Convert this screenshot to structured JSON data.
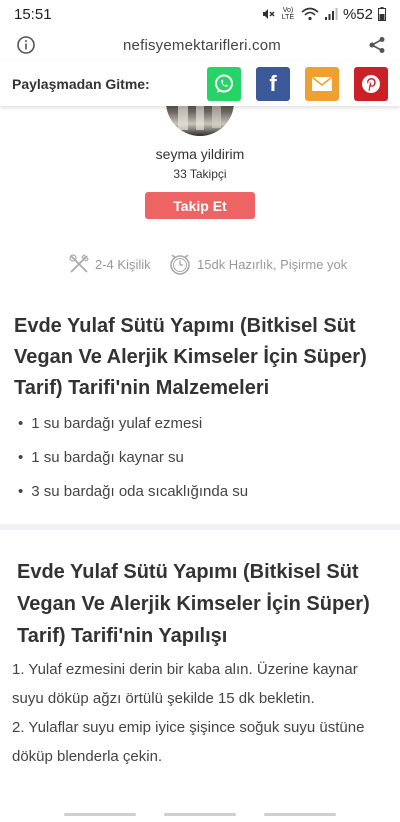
{
  "status_bar": {
    "time": "15:51",
    "network": "Vo) LTE",
    "battery": "%52"
  },
  "browser": {
    "url": "nefisyemektarifleri.com"
  },
  "share_bar": {
    "label": "Paylaşmadan Gitme:",
    "buttons": [
      {
        "name": "whatsapp",
        "color": "#25d366"
      },
      {
        "name": "facebook",
        "glyph": "f",
        "color": "#3b5998"
      },
      {
        "name": "email",
        "color": "#f0a030"
      },
      {
        "name": "pinterest",
        "color": "#cb2027"
      }
    ]
  },
  "author": {
    "name": "seyma yildirim",
    "followers": "33 Takipçi",
    "follow_label": "Takip Et"
  },
  "meta": {
    "portions": "2-4 Kişilik",
    "time": "15dk Hazırlık, Pişirme yok"
  },
  "ingredients": {
    "title": "Evde Yulaf Sütü Yapımı (Bitkisel Süt Vegan Ve Alerjik Kimseler İçin Süper) Tarif) Tarifi'nin Malzemeleri",
    "items": [
      "1 su bardağı yulaf ezmesi",
      "1 su bardağı kaynar su",
      "3 su bardağı oda sıcaklığında su"
    ]
  },
  "steps": {
    "title": "Evde Yulaf Sütü Yapımı (Bitkisel Süt Vegan Ve Alerjik Kimseler İçin Süper) Tarif) Tarifi'nin Yapılışı",
    "items": [
      "1. Yulaf ezmesini derin bir kaba alın. Üzerine kaynar suyu döküp ağzı örtülü şekilde 15 dk bekletin.",
      "2. Yulaflar suyu emip iyice şişince soğuk suyu üstüne döküp blenderla çekin."
    ]
  }
}
